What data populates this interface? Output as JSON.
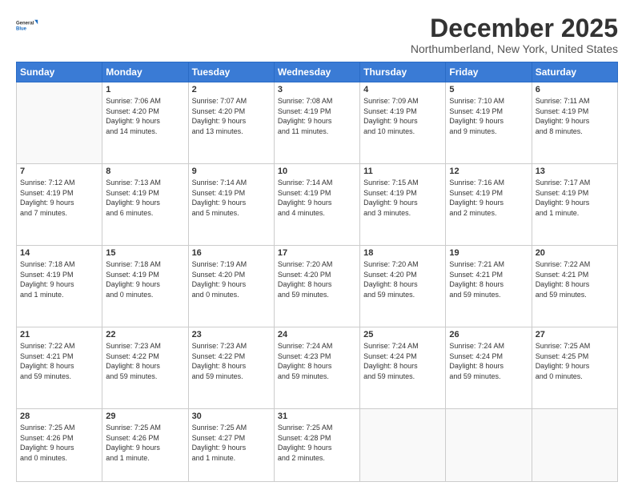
{
  "logo": {
    "line1": "General",
    "line2": "Blue"
  },
  "header": {
    "month": "December 2025",
    "location": "Northumberland, New York, United States"
  },
  "weekdays": [
    "Sunday",
    "Monday",
    "Tuesday",
    "Wednesday",
    "Thursday",
    "Friday",
    "Saturday"
  ],
  "weeks": [
    [
      {
        "day": "",
        "info": ""
      },
      {
        "day": "1",
        "info": "Sunrise: 7:06 AM\nSunset: 4:20 PM\nDaylight: 9 hours\nand 14 minutes."
      },
      {
        "day": "2",
        "info": "Sunrise: 7:07 AM\nSunset: 4:20 PM\nDaylight: 9 hours\nand 13 minutes."
      },
      {
        "day": "3",
        "info": "Sunrise: 7:08 AM\nSunset: 4:19 PM\nDaylight: 9 hours\nand 11 minutes."
      },
      {
        "day": "4",
        "info": "Sunrise: 7:09 AM\nSunset: 4:19 PM\nDaylight: 9 hours\nand 10 minutes."
      },
      {
        "day": "5",
        "info": "Sunrise: 7:10 AM\nSunset: 4:19 PM\nDaylight: 9 hours\nand 9 minutes."
      },
      {
        "day": "6",
        "info": "Sunrise: 7:11 AM\nSunset: 4:19 PM\nDaylight: 9 hours\nand 8 minutes."
      }
    ],
    [
      {
        "day": "7",
        "info": "Sunrise: 7:12 AM\nSunset: 4:19 PM\nDaylight: 9 hours\nand 7 minutes."
      },
      {
        "day": "8",
        "info": "Sunrise: 7:13 AM\nSunset: 4:19 PM\nDaylight: 9 hours\nand 6 minutes."
      },
      {
        "day": "9",
        "info": "Sunrise: 7:14 AM\nSunset: 4:19 PM\nDaylight: 9 hours\nand 5 minutes."
      },
      {
        "day": "10",
        "info": "Sunrise: 7:14 AM\nSunset: 4:19 PM\nDaylight: 9 hours\nand 4 minutes."
      },
      {
        "day": "11",
        "info": "Sunrise: 7:15 AM\nSunset: 4:19 PM\nDaylight: 9 hours\nand 3 minutes."
      },
      {
        "day": "12",
        "info": "Sunrise: 7:16 AM\nSunset: 4:19 PM\nDaylight: 9 hours\nand 2 minutes."
      },
      {
        "day": "13",
        "info": "Sunrise: 7:17 AM\nSunset: 4:19 PM\nDaylight: 9 hours\nand 1 minute."
      }
    ],
    [
      {
        "day": "14",
        "info": "Sunrise: 7:18 AM\nSunset: 4:19 PM\nDaylight: 9 hours\nand 1 minute."
      },
      {
        "day": "15",
        "info": "Sunrise: 7:18 AM\nSunset: 4:19 PM\nDaylight: 9 hours\nand 0 minutes."
      },
      {
        "day": "16",
        "info": "Sunrise: 7:19 AM\nSunset: 4:20 PM\nDaylight: 9 hours\nand 0 minutes."
      },
      {
        "day": "17",
        "info": "Sunrise: 7:20 AM\nSunset: 4:20 PM\nDaylight: 8 hours\nand 59 minutes."
      },
      {
        "day": "18",
        "info": "Sunrise: 7:20 AM\nSunset: 4:20 PM\nDaylight: 8 hours\nand 59 minutes."
      },
      {
        "day": "19",
        "info": "Sunrise: 7:21 AM\nSunset: 4:21 PM\nDaylight: 8 hours\nand 59 minutes."
      },
      {
        "day": "20",
        "info": "Sunrise: 7:22 AM\nSunset: 4:21 PM\nDaylight: 8 hours\nand 59 minutes."
      }
    ],
    [
      {
        "day": "21",
        "info": "Sunrise: 7:22 AM\nSunset: 4:21 PM\nDaylight: 8 hours\nand 59 minutes."
      },
      {
        "day": "22",
        "info": "Sunrise: 7:23 AM\nSunset: 4:22 PM\nDaylight: 8 hours\nand 59 minutes."
      },
      {
        "day": "23",
        "info": "Sunrise: 7:23 AM\nSunset: 4:22 PM\nDaylight: 8 hours\nand 59 minutes."
      },
      {
        "day": "24",
        "info": "Sunrise: 7:24 AM\nSunset: 4:23 PM\nDaylight: 8 hours\nand 59 minutes."
      },
      {
        "day": "25",
        "info": "Sunrise: 7:24 AM\nSunset: 4:24 PM\nDaylight: 8 hours\nand 59 minutes."
      },
      {
        "day": "26",
        "info": "Sunrise: 7:24 AM\nSunset: 4:24 PM\nDaylight: 8 hours\nand 59 minutes."
      },
      {
        "day": "27",
        "info": "Sunrise: 7:25 AM\nSunset: 4:25 PM\nDaylight: 9 hours\nand 0 minutes."
      }
    ],
    [
      {
        "day": "28",
        "info": "Sunrise: 7:25 AM\nSunset: 4:26 PM\nDaylight: 9 hours\nand 0 minutes."
      },
      {
        "day": "29",
        "info": "Sunrise: 7:25 AM\nSunset: 4:26 PM\nDaylight: 9 hours\nand 1 minute."
      },
      {
        "day": "30",
        "info": "Sunrise: 7:25 AM\nSunset: 4:27 PM\nDaylight: 9 hours\nand 1 minute."
      },
      {
        "day": "31",
        "info": "Sunrise: 7:25 AM\nSunset: 4:28 PM\nDaylight: 9 hours\nand 2 minutes."
      },
      {
        "day": "",
        "info": ""
      },
      {
        "day": "",
        "info": ""
      },
      {
        "day": "",
        "info": ""
      }
    ]
  ]
}
